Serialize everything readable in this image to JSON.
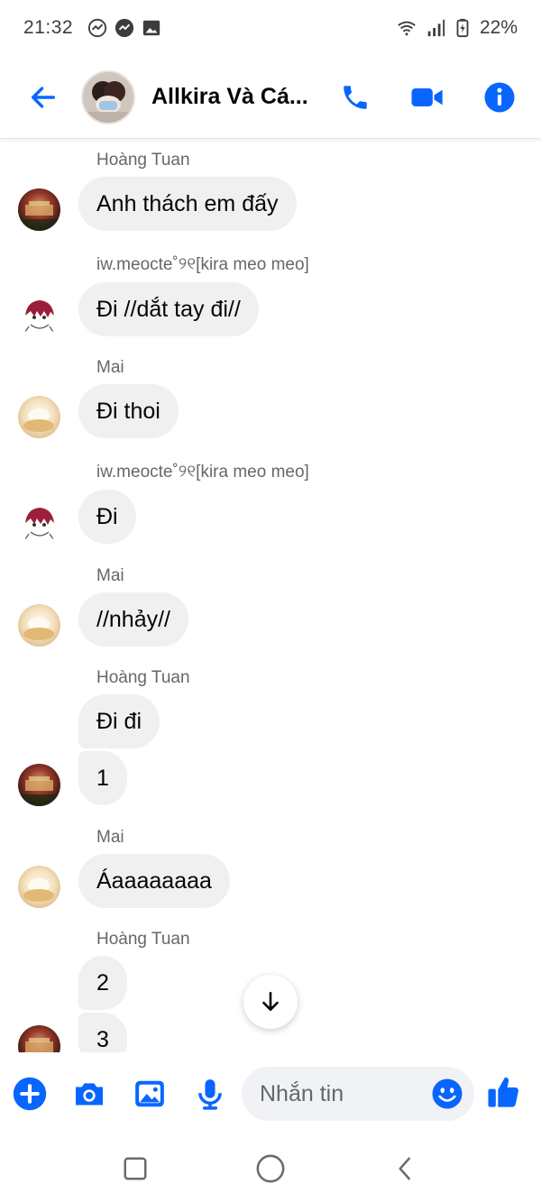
{
  "status": {
    "time": "21:32",
    "battery": "22%",
    "left_icons": [
      "messenger-icon",
      "messenger-icon",
      "image-icon"
    ],
    "right_icons": [
      "wifi-icon",
      "signal-icon",
      "battery-icon"
    ]
  },
  "header": {
    "title": "Allkira Và Cá...",
    "back": "arrow-left-icon",
    "actions": [
      "phone-icon",
      "video-icon",
      "info-icon"
    ]
  },
  "messages": [
    {
      "sender": "Hoàng Tuan",
      "texts": [
        "Anh thách em đấy"
      ]
    },
    {
      "sender": "iw.meocte˚୨୧[kira meo meo]",
      "texts": [
        "Đi //dắt tay đi//"
      ]
    },
    {
      "sender": "Mai",
      "texts": [
        "Đi thoi"
      ]
    },
    {
      "sender": "iw.meocte˚୨୧[kira meo meo]",
      "texts": [
        "Đi"
      ]
    },
    {
      "sender": "Mai",
      "texts": [
        "//nhảy//"
      ]
    },
    {
      "sender": "Hoàng Tuan",
      "texts": [
        "Đi đi",
        "1"
      ]
    },
    {
      "sender": "Mai",
      "texts": [
        "Áaaaaaaaa"
      ]
    },
    {
      "sender": "Hoàng Tuan",
      "texts": [
        "2",
        "3"
      ]
    }
  ],
  "composer": {
    "placeholder": "Nhắn tin",
    "buttons": [
      "plus-icon",
      "camera-icon",
      "gallery-icon",
      "microphone-icon",
      "emoji-icon",
      "like-icon"
    ]
  },
  "colors": {
    "accent": "#0866ff",
    "bubble": "#f0f0f0",
    "sender": "#65676b"
  }
}
